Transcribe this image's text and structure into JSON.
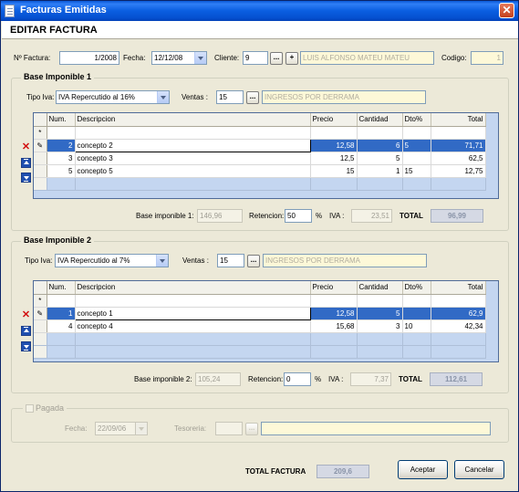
{
  "window": {
    "title": "Facturas Emitidas"
  },
  "header": {
    "title": "EDITAR FACTURA"
  },
  "top": {
    "nfactura_label": "Nº Factura:",
    "nfactura_value": "1/2008",
    "fecha_label": "Fecha:",
    "fecha_value": "12/12/08",
    "cliente_label": "Cliente:",
    "cliente_value": "9",
    "cliente_name": "LUIS ALFONSO MATEU MATEU",
    "codigo_label": "Codigo:",
    "codigo_value": "1",
    "browse_label": "...",
    "add_label": "+"
  },
  "base1": {
    "title": "Base Imponible 1",
    "tipo_label": "Tipo Iva:",
    "tipo_value": "IVA Repercutido al 16%",
    "ventas_label": "Ventas :",
    "ventas_value": "15",
    "ventas_name": "INGRESOS POR DERRAMA",
    "browse_label": "...",
    "columns": [
      "Num.",
      "Descripcion",
      "Precio",
      "Cantidad",
      "Dto%",
      "Total"
    ],
    "new_row_marker": "*",
    "rows": [
      {
        "num": "2",
        "desc": "concepto 2",
        "precio": "12,58",
        "cantidad": "6",
        "dto": "5",
        "total": "71,71"
      },
      {
        "num": "3",
        "desc": "concepto 3",
        "precio": "12,5",
        "cantidad": "5",
        "dto": "",
        "total": "62,5"
      },
      {
        "num": "5",
        "desc": "concepto 5",
        "precio": "15",
        "cantidad": "1",
        "dto": "15",
        "total": "12,75"
      }
    ],
    "base_label": "Base imponible 1:",
    "base_value": "146,96",
    "ret_label": "Retencion:",
    "ret_value": "50",
    "pct": "%",
    "iva_label": "IVA :",
    "iva_value": "23,51",
    "total_label": "TOTAL",
    "total_value": "96,99"
  },
  "base2": {
    "title": "Base Imponible 2",
    "tipo_label": "Tipo Iva:",
    "tipo_value": "IVA Repercutido al 7%",
    "ventas_label": "Ventas :",
    "ventas_value": "15",
    "ventas_name": "INGRESOS POR DERRAMA",
    "browse_label": "...",
    "columns": [
      "Num.",
      "Descripcion",
      "Precio",
      "Cantidad",
      "Dto%",
      "Total"
    ],
    "new_row_marker": "*",
    "rows": [
      {
        "num": "1",
        "desc": "concepto 1",
        "precio": "12,58",
        "cantidad": "5",
        "dto": "",
        "total": "62,9"
      },
      {
        "num": "4",
        "desc": "concepto 4",
        "precio": "15,68",
        "cantidad": "3",
        "dto": "10",
        "total": "42,34"
      }
    ],
    "base_label": "Base imponible 2:",
    "base_value": "105,24",
    "ret_label": "Retencion:",
    "ret_value": "0",
    "pct": "%",
    "iva_label": "IVA :",
    "iva_value": "7,37",
    "total_label": "TOTAL",
    "total_value": "112,61"
  },
  "pagada": {
    "label": "Pagada",
    "fecha_label": "Fecha:",
    "fecha_value": "22/09/06",
    "tesoreria_label": "Tesoreria:",
    "browse_label": "..."
  },
  "footer": {
    "total_label": "TOTAL FACTURA",
    "total_value": "209,6",
    "accept_label": "Aceptar",
    "cancel_label": "Cancelar"
  },
  "colors": {
    "titlebar": "#0a5ee0",
    "selection": "#316ac5",
    "grid_bg": "#c4d6f0"
  }
}
